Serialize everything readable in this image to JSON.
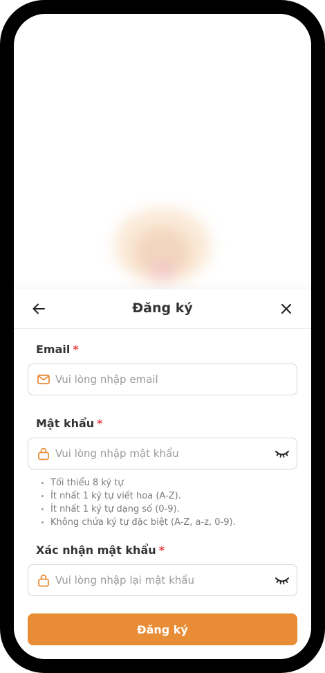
{
  "header": {
    "title": "Đăng ký"
  },
  "form": {
    "email": {
      "label": "Email",
      "required_mark": "*",
      "placeholder": "Vui lòng nhập email",
      "value": ""
    },
    "password": {
      "label": "Mật khẩu",
      "required_mark": "*",
      "placeholder": "Vui lòng nhập mật khẩu",
      "value": "",
      "rules": [
        "Tối thiểu 8 ký tự",
        "Ít nhất 1 ký tự viết hoa (A-Z).",
        "Ít nhất 1 ký tự dạng số (0-9).",
        "Không chứa ký tự đặc biệt (A-Z, a-z, 0-9)."
      ]
    },
    "confirm_password": {
      "label": "Xác nhận mật khẩu",
      "required_mark": "*",
      "placeholder": "Vui lòng nhập lại mật khẩu",
      "value": ""
    },
    "submit_label": "Đăng ký"
  },
  "icons": {
    "back": "arrow-left-icon",
    "close": "close-icon",
    "email": "mail-icon",
    "lock": "lock-icon",
    "eye": "eye-closed-icon"
  },
  "colors": {
    "accent": "#e88c36",
    "required": "#e5484d",
    "border": "#d4d4d4",
    "placeholder": "#9a9a9a"
  }
}
